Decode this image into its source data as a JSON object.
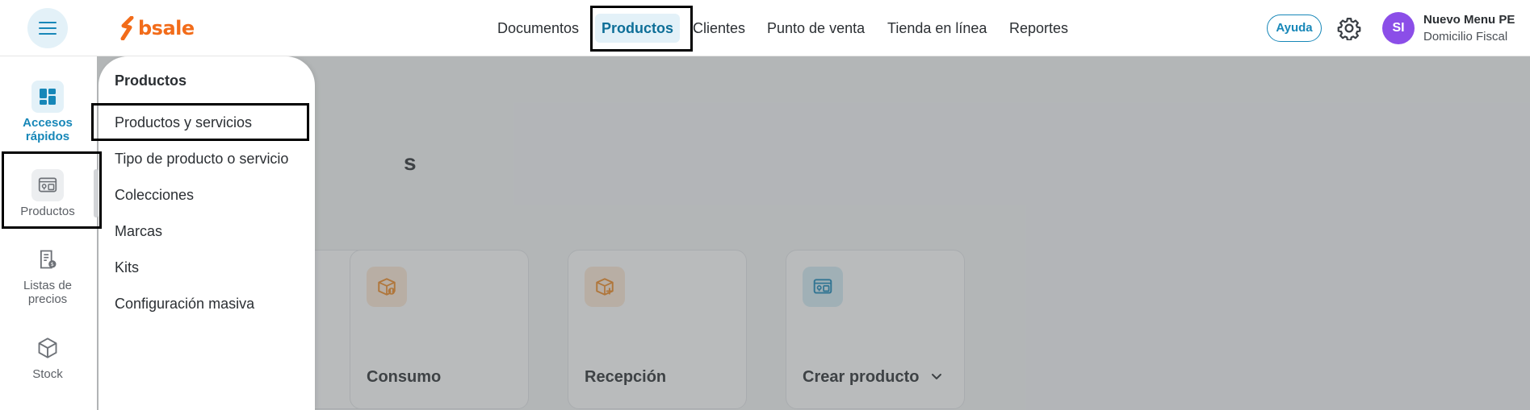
{
  "brand": {
    "name": "bsale",
    "color": "#f26c1a"
  },
  "header": {
    "nav": [
      {
        "label": "Documentos"
      },
      {
        "label": "Productos",
        "active": true
      },
      {
        "label": "Clientes"
      },
      {
        "label": "Punto de venta"
      },
      {
        "label": "Tienda en línea"
      },
      {
        "label": "Reportes"
      }
    ],
    "help_label": "Ayuda",
    "settings_icon": "gear-icon",
    "user": {
      "initials": "SI",
      "name": "Nuevo Menu PE",
      "subtitle": "Domicilio Fiscal"
    }
  },
  "rail": {
    "items": [
      {
        "label": "Accesos rápidos",
        "icon": "dashboard-icon",
        "active": true
      },
      {
        "label": "Productos",
        "icon": "product-box-icon",
        "selected": true
      },
      {
        "label": "Listas de precios",
        "icon": "price-list-icon"
      },
      {
        "label": "Stock",
        "icon": "cube-icon"
      }
    ]
  },
  "flyout": {
    "title": "Productos",
    "items": [
      {
        "label": "Productos y servicios"
      },
      {
        "label": "Tipo de producto o servicio"
      },
      {
        "label": "Colecciones"
      },
      {
        "label": "Marcas"
      },
      {
        "label": "Kits"
      },
      {
        "label": "Configuración masiva"
      }
    ]
  },
  "main": {
    "title_fragment": "s",
    "cards": [
      {
        "label": "",
        "icon": ""
      },
      {
        "label": "Consumo",
        "icon": "box-alert-icon",
        "color": "#f08a24"
      },
      {
        "label": "Recepción",
        "icon": "box-plus-icon",
        "color": "#f08a24"
      },
      {
        "label": "Crear producto",
        "icon": "product-box-icon",
        "color": "#1787b8",
        "has_dropdown": true
      }
    ]
  },
  "colors": {
    "accent": "#1787b8",
    "avatar": "#8b4ee8"
  }
}
